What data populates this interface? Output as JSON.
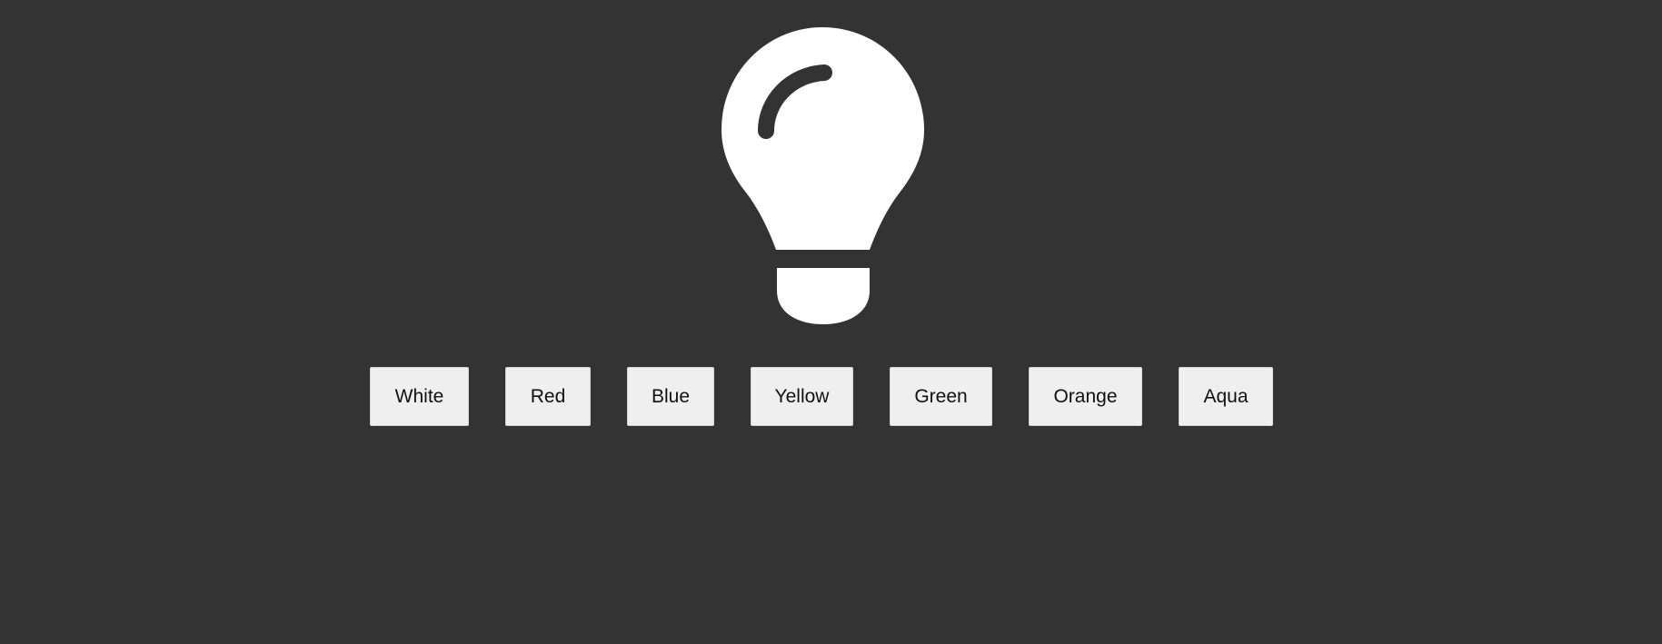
{
  "theme": {
    "background": "#333333",
    "bulb_color": "#ffffff",
    "button_background": "#efefef"
  },
  "bulb": {
    "icon": "lightbulb-icon"
  },
  "buttons": [
    {
      "label": "White"
    },
    {
      "label": "Red"
    },
    {
      "label": "Blue"
    },
    {
      "label": "Yellow"
    },
    {
      "label": "Green"
    },
    {
      "label": "Orange"
    },
    {
      "label": "Aqua"
    }
  ]
}
